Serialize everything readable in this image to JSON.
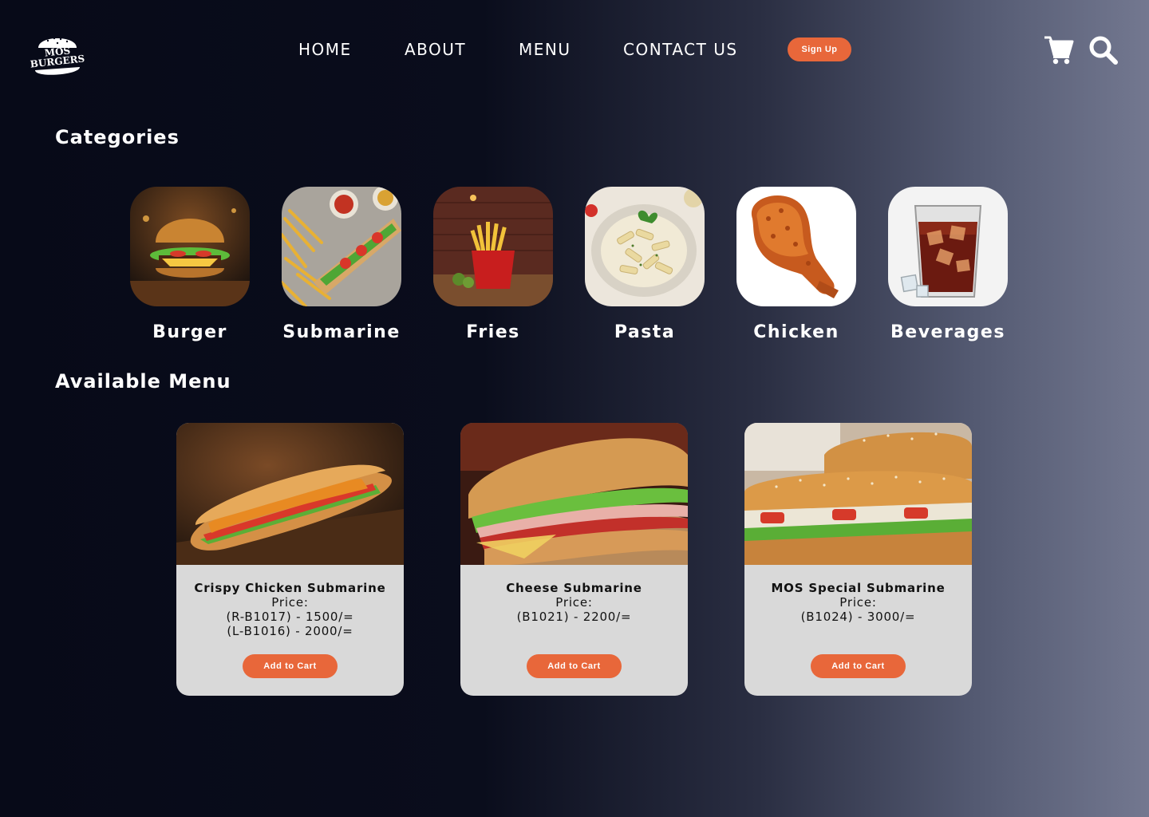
{
  "brand": {
    "logo_text_top": "MOS",
    "logo_text_bottom": "BURGERS"
  },
  "nav": {
    "items": [
      {
        "label": "HOME"
      },
      {
        "label": "ABOUT"
      },
      {
        "label": "MENU"
      },
      {
        "label": "CONTACT US"
      }
    ],
    "signup_label": "Sign Up"
  },
  "icons": {
    "cart": "cart-icon",
    "search": "search-icon"
  },
  "categories": {
    "title": "Categories",
    "items": [
      {
        "label": "Burger"
      },
      {
        "label": "Submarine"
      },
      {
        "label": "Fries"
      },
      {
        "label": "Pasta"
      },
      {
        "label": "Chicken"
      },
      {
        "label": "Beverages"
      }
    ]
  },
  "menu": {
    "title": "Available Menu",
    "price_label": "Price:",
    "add_label": "Add to Cart",
    "items": [
      {
        "name": "Crispy Chicken Submarine",
        "prices": [
          "(R-B1017) - 1500/=",
          "(L-B1016) - 2000/="
        ]
      },
      {
        "name": "Cheese Submarine",
        "prices": [
          "(B1021) - 2200/="
        ]
      },
      {
        "name": "MOS Special Submarine",
        "prices": [
          "(B1024) - 3000/="
        ]
      }
    ]
  },
  "colors": {
    "accent": "#e8673a",
    "card_bg": "#d9d9d9",
    "bg_dark": "#070a18",
    "bg_light": "#737890"
  }
}
